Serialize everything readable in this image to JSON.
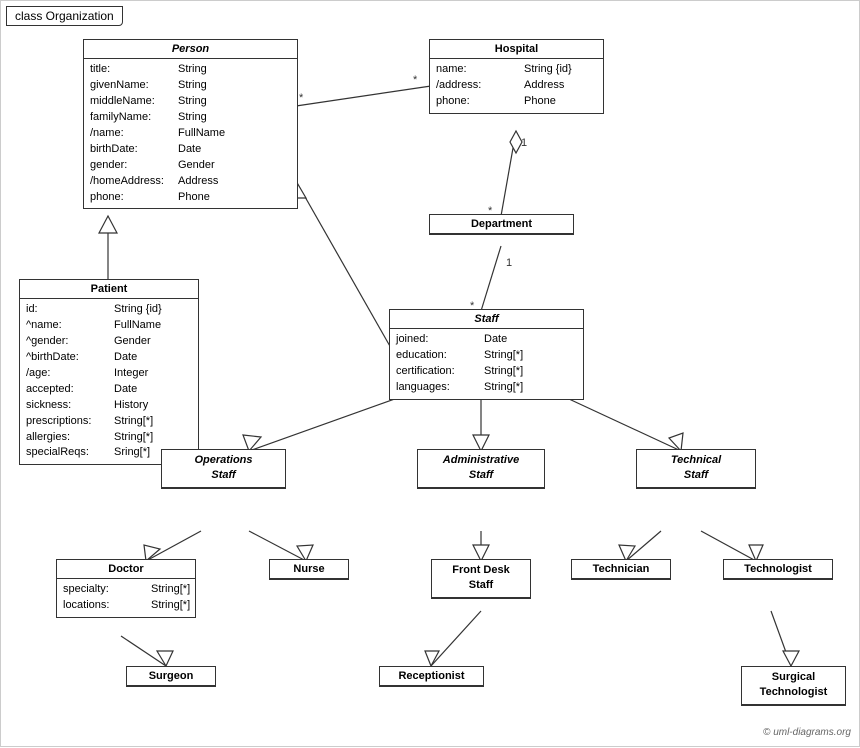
{
  "title": "class Organization",
  "classes": {
    "person": {
      "name": "Person",
      "italic": true,
      "attrs": [
        {
          "name": "title:",
          "type": "String"
        },
        {
          "name": "givenName:",
          "type": "String"
        },
        {
          "name": "middleName:",
          "type": "String"
        },
        {
          "name": "familyName:",
          "type": "String"
        },
        {
          "name": "/name:",
          "type": "FullName"
        },
        {
          "name": "birthDate:",
          "type": "Date"
        },
        {
          "name": "gender:",
          "type": "Gender"
        },
        {
          "name": "/homeAddress:",
          "type": "Address"
        },
        {
          "name": "phone:",
          "type": "Phone"
        }
      ]
    },
    "hospital": {
      "name": "Hospital",
      "italic": false,
      "attrs": [
        {
          "name": "name:",
          "type": "String {id}"
        },
        {
          "name": "/address:",
          "type": "Address"
        },
        {
          "name": "phone:",
          "type": "Phone"
        }
      ]
    },
    "patient": {
      "name": "Patient",
      "italic": false,
      "attrs": [
        {
          "name": "id:",
          "type": "String {id}"
        },
        {
          "name": "^name:",
          "type": "FullName"
        },
        {
          "name": "^gender:",
          "type": "Gender"
        },
        {
          "name": "^birthDate:",
          "type": "Date"
        },
        {
          "name": "/age:",
          "type": "Integer"
        },
        {
          "name": "accepted:",
          "type": "Date"
        },
        {
          "name": "sickness:",
          "type": "History"
        },
        {
          "name": "prescriptions:",
          "type": "String[*]"
        },
        {
          "name": "allergies:",
          "type": "String[*]"
        },
        {
          "name": "specialReqs:",
          "type": "Sring[*]"
        }
      ]
    },
    "department": {
      "name": "Department",
      "italic": false,
      "attrs": []
    },
    "staff": {
      "name": "Staff",
      "italic": true,
      "attrs": [
        {
          "name": "joined:",
          "type": "Date"
        },
        {
          "name": "education:",
          "type": "String[*]"
        },
        {
          "name": "certification:",
          "type": "String[*]"
        },
        {
          "name": "languages:",
          "type": "String[*]"
        }
      ]
    },
    "operations_staff": {
      "name": "Operations Staff",
      "italic": true,
      "attrs": []
    },
    "administrative_staff": {
      "name": "Administrative Staff",
      "italic": true,
      "attrs": []
    },
    "technical_staff": {
      "name": "Technical Staff",
      "italic": true,
      "attrs": []
    },
    "doctor": {
      "name": "Doctor",
      "italic": false,
      "attrs": [
        {
          "name": "specialty:",
          "type": "String[*]"
        },
        {
          "name": "locations:",
          "type": "String[*]"
        }
      ]
    },
    "nurse": {
      "name": "Nurse",
      "italic": false,
      "attrs": []
    },
    "front_desk_staff": {
      "name": "Front Desk Staff",
      "italic": false,
      "attrs": []
    },
    "technician": {
      "name": "Technician",
      "italic": false,
      "attrs": []
    },
    "technologist": {
      "name": "Technologist",
      "italic": false,
      "attrs": []
    },
    "surgeon": {
      "name": "Surgeon",
      "italic": false,
      "attrs": []
    },
    "receptionist": {
      "name": "Receptionist",
      "italic": false,
      "attrs": []
    },
    "surgical_technologist": {
      "name": "Surgical Technologist",
      "italic": false,
      "attrs": []
    }
  },
  "copyright": "© uml-diagrams.org"
}
